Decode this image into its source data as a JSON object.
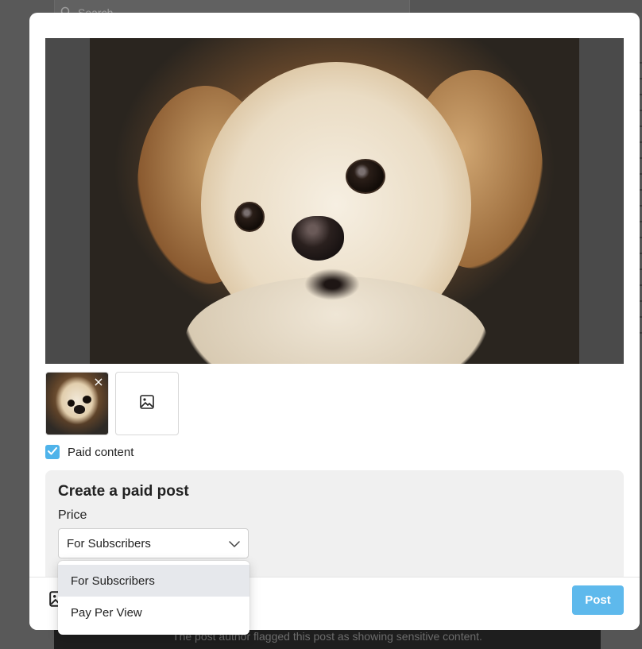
{
  "background": {
    "search_placeholder": "Search",
    "sensitive_notice": "The post author flagged this post as showing sensitive content."
  },
  "media": {
    "thumbnail_remove_label": "×",
    "preview_icon": "photo-of-dog",
    "add_media_icon": "image-icon"
  },
  "paid_content": {
    "checked": true,
    "label": "Paid content"
  },
  "paid_panel": {
    "title": "Create a paid post",
    "price_label": "Price",
    "selected_option": "For Subscribers",
    "options": [
      "For Subscribers",
      "Pay Per View"
    ]
  },
  "footer": {
    "media_icon": "image-icon",
    "post_label": "Post"
  },
  "colors": {
    "accent": "#5eb9ec",
    "checkbox": "#4fb3ea",
    "panel_bg": "#f0f0f0",
    "option_highlight": "#e6e8ec"
  }
}
